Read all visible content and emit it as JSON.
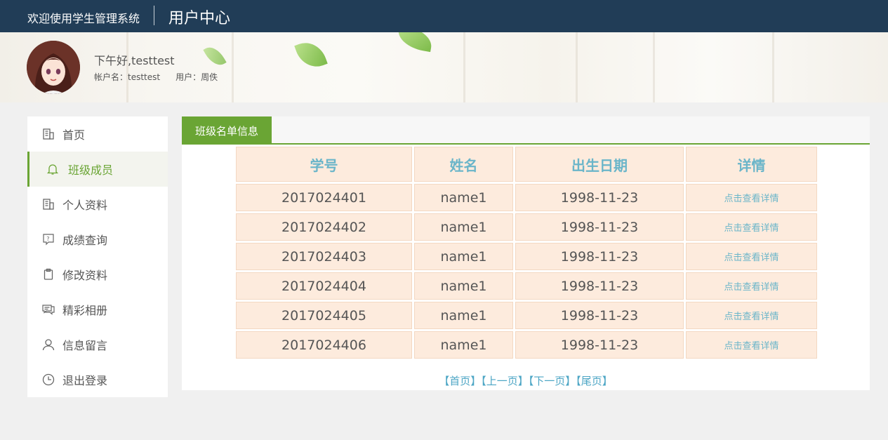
{
  "header": {
    "site_title": "欢迎使用学生管理系统",
    "page_title": "用户中心"
  },
  "profile": {
    "greeting": "下午好,testtest",
    "account_label": "帐户名：testtest",
    "user_label": "用户：周佚"
  },
  "sidebar": {
    "items": [
      {
        "label": "首页",
        "icon": "building-icon",
        "active": false
      },
      {
        "label": "班级成员",
        "icon": "bell-icon",
        "active": true
      },
      {
        "label": "个人资料",
        "icon": "building-icon",
        "active": false
      },
      {
        "label": "成绩查询",
        "icon": "question-icon",
        "active": false
      },
      {
        "label": "修改资料",
        "icon": "clipboard-icon",
        "active": false
      },
      {
        "label": "精彩相册",
        "icon": "chat-icon",
        "active": false
      },
      {
        "label": "信息留言",
        "icon": "user-icon",
        "active": false
      },
      {
        "label": "退出登录",
        "icon": "clock-icon",
        "active": false
      }
    ]
  },
  "main": {
    "tab_label": "班级名单信息",
    "table": {
      "headers": [
        "学号",
        "姓名",
        "出生日期",
        "详情"
      ],
      "rows": [
        {
          "id": "2017024401",
          "name": "name1",
          "birth": "1998-11-23",
          "detail": "点击查看详情"
        },
        {
          "id": "2017024402",
          "name": "name1",
          "birth": "1998-11-23",
          "detail": "点击查看详情"
        },
        {
          "id": "2017024403",
          "name": "name1",
          "birth": "1998-11-23",
          "detail": "点击查看详情"
        },
        {
          "id": "2017024404",
          "name": "name1",
          "birth": "1998-11-23",
          "detail": "点击查看详情"
        },
        {
          "id": "2017024405",
          "name": "name1",
          "birth": "1998-11-23",
          "detail": "点击查看详情"
        },
        {
          "id": "2017024406",
          "name": "name1",
          "birth": "1998-11-23",
          "detail": "点击查看详情"
        }
      ]
    },
    "pager": {
      "first": "【首页】",
      "prev": "【上一页】",
      "next": "【下一页】",
      "last": "【尾页】"
    }
  },
  "colors": {
    "topbar": "#213d57",
    "accent_green": "#6aa534",
    "cell_bg": "#fdebdd",
    "link_blue": "#6ab5c9"
  }
}
